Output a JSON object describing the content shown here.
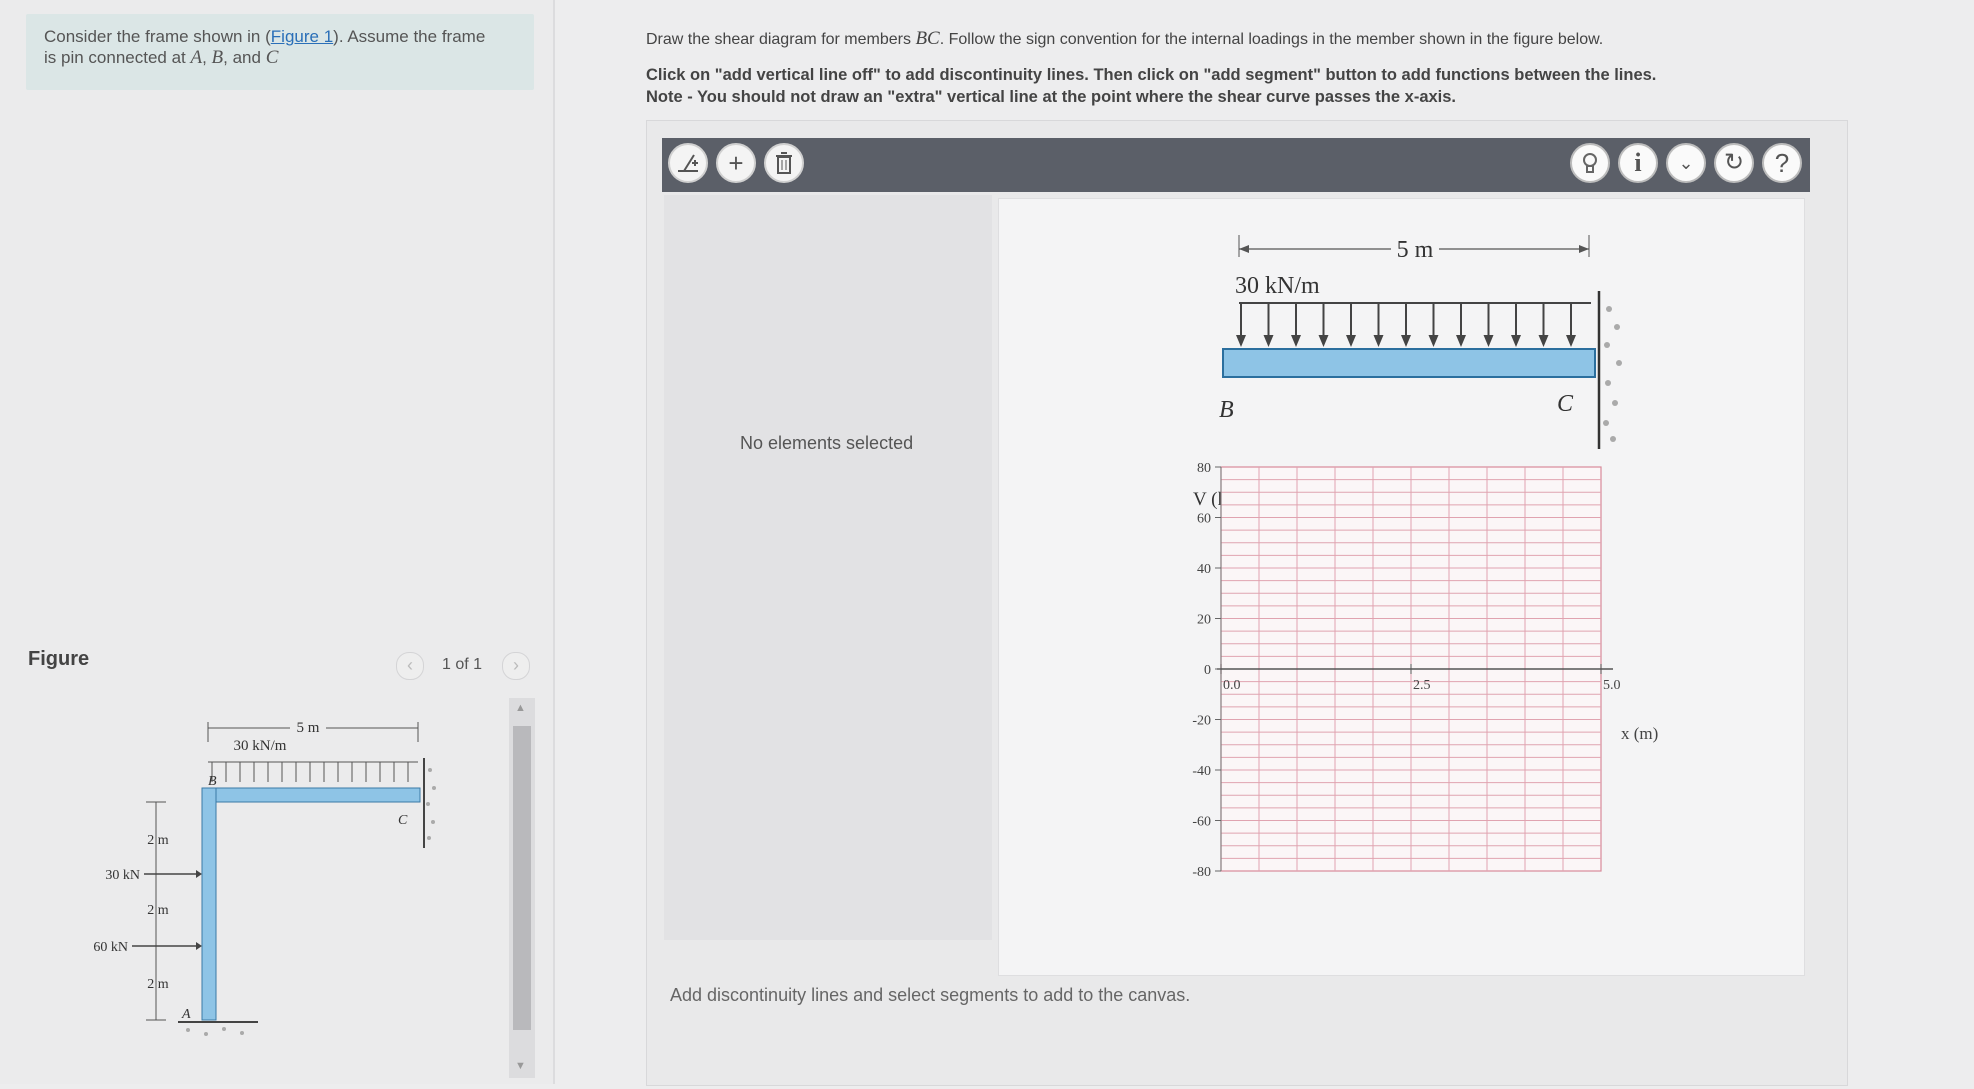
{
  "problem": {
    "prefix": "Consider the frame shown in (",
    "figure_link": "Figure 1",
    "suffix_a": "). Assume the frame",
    "suffix_b": "is pin connected at ",
    "pins_a": "A",
    "comma1": ", ",
    "pins_b": "B",
    "and_text": ", and ",
    "pins_c": "C"
  },
  "figure_panel": {
    "label": "Figure",
    "pager_text": "1 of 1",
    "prev_icon": "chevron-left-icon",
    "next_icon": "chevron-right-icon"
  },
  "figure1": {
    "span_label": "5 m",
    "load_label": "30 kN/m",
    "node_b": "B",
    "node_c": "C",
    "node_a": "A",
    "seg1": "2 m",
    "seg2": "2 m",
    "seg3": "2 m",
    "force1": "30 kN",
    "force2": "60 kN"
  },
  "instructions": {
    "line1_prefix": "Draw the shear diagram for members ",
    "line1_member": "BC",
    "line1_suffix": ". Follow the sign convention for the internal loadings in the member shown in the figure below.",
    "line2": "Click on \"add vertical line off\" to add discontinuity lines. Then click on \"add segment\" button to add functions between the lines.",
    "line3": "Note - You should not draw an \"extra\" vertical line at the point where the shear curve passes the x-axis."
  },
  "toolbar": {
    "left_icons": [
      "add-vertical-line-icon",
      "add-segment-icon",
      "delete-icon"
    ],
    "right_icons": [
      "hint-lightbulb-icon",
      "info-icon",
      "dropdown-icon",
      "reset-icon",
      "help-icon"
    ]
  },
  "properties": {
    "empty_text": "No elements selected"
  },
  "beam": {
    "span_label": "5 m",
    "load_label": "30 kN/m",
    "node_b": "B",
    "node_c": "C"
  },
  "graph": {
    "y_label": "V (kN)",
    "x_label": "x (m)",
    "y_ticks": [
      "80",
      "60",
      "40",
      "20",
      "0",
      "-20",
      "-40",
      "-60",
      "-80"
    ],
    "x_ticks": [
      "0.0",
      "2.5",
      "5.0"
    ]
  },
  "hint": {
    "bottom_text": "Add discontinuity lines and select segments to add to the canvas."
  }
}
